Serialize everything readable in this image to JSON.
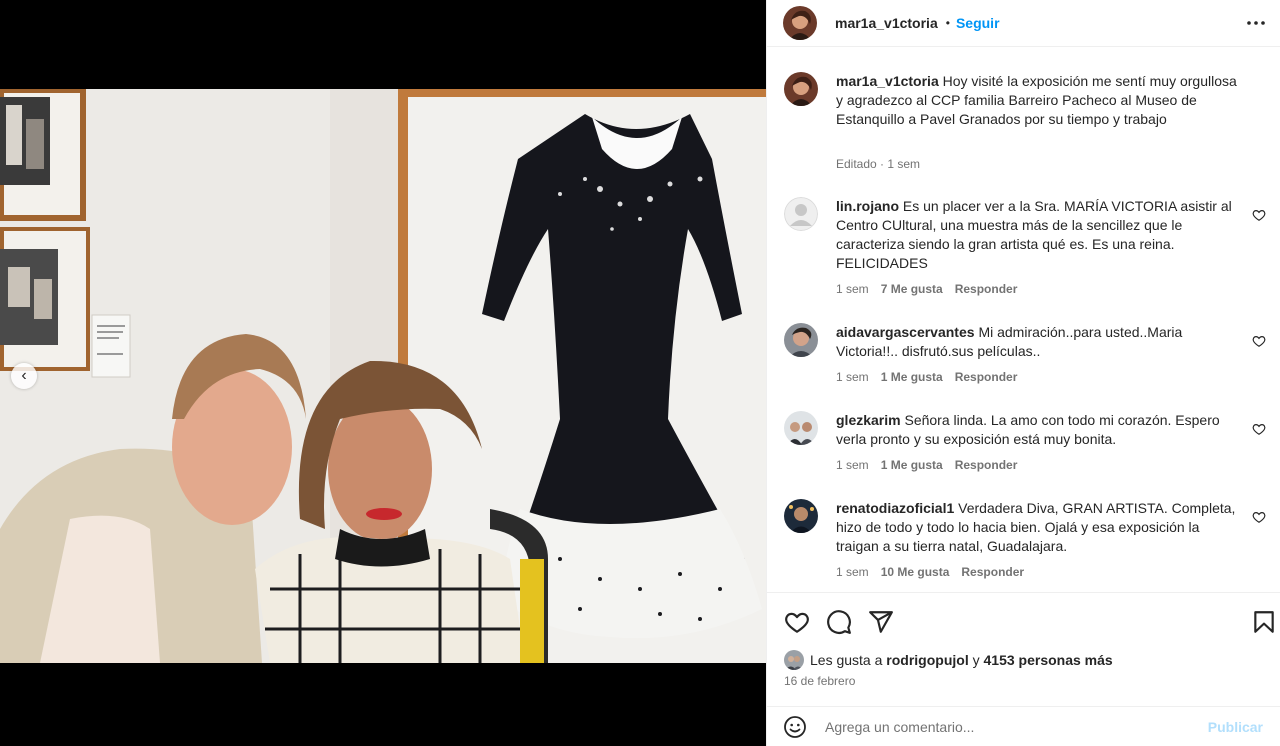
{
  "post": {
    "username": "mar1a_v1ctoria",
    "follow_label": "Seguir",
    "separator": "•",
    "more_icon": "more-horizontal-icon",
    "caption": {
      "username": "mar1a_v1ctoria",
      "text": "Hoy visité la exposición me sentí muy orgullosa y agradezco al CCP familia Barreiro Pacheco al Museo de Estanquillo a Pavel Granados por su tiempo y trabajo",
      "edited": "Editado",
      "time": "1 sem"
    },
    "comments": [
      {
        "username": "lin.rojano",
        "text": "Es un placer ver a la Sra. MARÍA VICTORIA asistir al Centro CUltural, una muestra más de la sencillez que le caracteriza siendo la gran artista qué es. Es una reina. FELICIDADES",
        "time": "1 sem",
        "likes": "7 Me gusta",
        "reply": "Responder"
      },
      {
        "username": "aidavargascervantes",
        "text": "Mi admiración..para usted..Maria Victoria!!.. disfrutó.sus películas..",
        "time": "1 sem",
        "likes": "1 Me gusta",
        "reply": "Responder"
      },
      {
        "username": "glezkarim",
        "text": "Señora linda. La amo con todo mi corazón. Espero verla pronto y su exposición está muy bonita.",
        "time": "1 sem",
        "likes": "1 Me gusta",
        "reply": "Responder"
      },
      {
        "username": "renatodiazoficial1",
        "text": "Verdadera Diva, GRAN ARTISTA. Completa, hizo de todo y todo lo hacia bien. Ojalá y esa exposición la traigan a su tierra natal, Guadalajara.",
        "time": "1 sem",
        "likes": "10 Me gusta",
        "reply": "Responder"
      }
    ],
    "likes_line": {
      "prefix": "Les gusta a",
      "user": "rodrigopujol",
      "connector": "y",
      "others": "4153 personas más"
    },
    "date": "16 de febrero",
    "add_comment": {
      "placeholder": "Agrega un comentario...",
      "publish_label": "Publicar"
    },
    "nav_prev_icon": "chevron-left-icon"
  },
  "colors": {
    "accent": "#0095f6",
    "publish_disabled": "#b2dffc",
    "muted": "#737373"
  }
}
